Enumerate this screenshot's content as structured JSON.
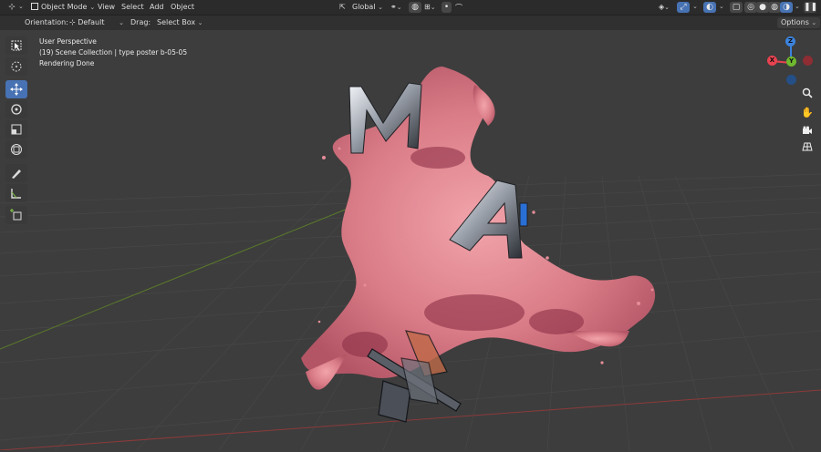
{
  "header": {
    "mode_label": "Object Mode",
    "menus": [
      "View",
      "Select",
      "Add",
      "Object"
    ],
    "transform_orientation": "Global",
    "options_label": "Options"
  },
  "tool_settings": {
    "orientation_label": "Orientation:",
    "orientation_value": "Default",
    "drag_label": "Drag:",
    "drag_value": "Select Box"
  },
  "viewport": {
    "view_name": "User Perspective",
    "collection_line": "(19) Scene Collection | type poster b-05-05",
    "status": "Rendering Done"
  },
  "gizmo": {
    "x": "X",
    "y": "Y",
    "z": "Z",
    "x_color": "#e84350",
    "y_color": "#6fb82e",
    "z_color": "#3b82dc"
  },
  "toolbar": {
    "active_tool": "move-icon",
    "tools": [
      "select-box-icon",
      "cursor-icon",
      "move-icon",
      "rotate-icon",
      "scale-icon",
      "transform-icon",
      "annotate-icon",
      "measure-icon",
      "add-cube-icon"
    ]
  },
  "colors": {
    "accent": "#4772b3",
    "grid_x_axis": "#8c3a3a",
    "grid_y_axis": "#5a7a2a",
    "fluid": "#d97b86"
  }
}
